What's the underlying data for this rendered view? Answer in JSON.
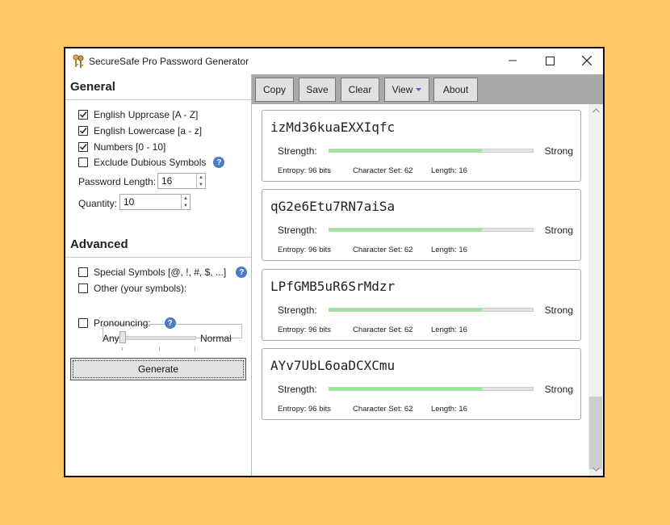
{
  "window": {
    "title": "SecureSafe Pro Password Generator"
  },
  "general": {
    "heading": "General",
    "options": [
      {
        "label": "English Upprcase [A - Z]",
        "checked": true
      },
      {
        "label": "English Lowercase [a - z]",
        "checked": true
      },
      {
        "label": "Numbers [0 - 10]",
        "checked": true
      },
      {
        "label": "Exclude Dubious Symbols",
        "checked": false
      }
    ],
    "length_label": "Password Length:",
    "length_value": "16",
    "quantity_label": "Quantity:",
    "quantity_value": "10"
  },
  "advanced": {
    "heading": "Advanced",
    "special_label": "Special Symbols [@, !, #, $, ...]",
    "other_label": "Other (your symbols):",
    "other_value": "",
    "pronouncing_label": "Pronouncing:",
    "slider_min_label": "Any",
    "slider_max_label": "Normal"
  },
  "generate_label": "Generate",
  "toolbar": {
    "copy": "Copy",
    "save": "Save",
    "clear": "Clear",
    "view": "View",
    "about": "About"
  },
  "passwords": [
    {
      "value": "izMd36kuaEXXIqfc",
      "strength_label": "Strength:",
      "strength": "Strong",
      "strength_fraction": 0.75,
      "entropy": "Entropy: 96 bits",
      "charset": "Character Set: 62",
      "length": "Length: 16"
    },
    {
      "value": "qG2e6Etu7RN7aiSa",
      "strength_label": "Strength:",
      "strength": "Strong",
      "strength_fraction": 0.75,
      "entropy": "Entropy: 96 bits",
      "charset": "Character Set: 62",
      "length": "Length: 16"
    },
    {
      "value": "LPfGMB5uR6SrMdzr",
      "strength_label": "Strength:",
      "strength": "Strong",
      "strength_fraction": 0.75,
      "entropy": "Entropy: 96 bits",
      "charset": "Character Set: 62",
      "length": "Length: 16"
    },
    {
      "value": "AYv7UbL6oaDCXCmu",
      "strength_label": "Strength:",
      "strength": "Strong",
      "strength_fraction": 0.75,
      "entropy": "Entropy: 96 bits",
      "charset": "Character Set: 62",
      "length": "Length: 16"
    }
  ],
  "colors": {
    "background": "#ffc766",
    "strength_bar": "#90ee90",
    "toolbar": "#a9a9a9",
    "help_badge": "#4a7dc4"
  },
  "icons": {
    "app": "keys-icon",
    "help": "question-icon"
  }
}
